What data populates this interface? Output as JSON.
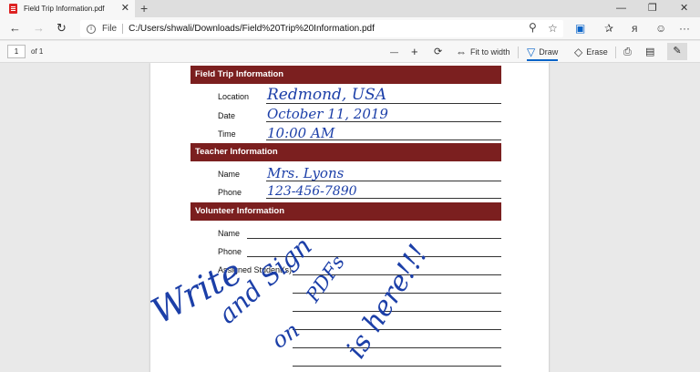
{
  "browser": {
    "tab_title": "Field Trip Information.pdf",
    "tab_close": "✕",
    "new_tab": "+",
    "window_controls": [
      "—",
      "❐",
      "✕"
    ],
    "url_scheme": "File",
    "url": "C:/Users/shwali/Downloads/Field%20Trip%20Information.pdf",
    "more": "···"
  },
  "pdf_toolbar": {
    "page_number": "1",
    "page_count": "of 1",
    "zoom_out": "—",
    "zoom_in": "+",
    "fit_label": "Fit to width",
    "draw_label": "Draw",
    "erase_label": "Erase"
  },
  "form": {
    "sections": [
      {
        "title": "Field Trip Information"
      },
      {
        "title": "Teacher Information"
      },
      {
        "title": "Volunteer Information"
      }
    ],
    "trip_fields": [
      {
        "label": "Location",
        "value": "Redmond, USA"
      },
      {
        "label": "Date",
        "value": "October 11, 2019"
      },
      {
        "label": "Time",
        "value": "10:00 AM"
      }
    ],
    "teacher_fields": [
      {
        "label": "Name",
        "value": "Mrs. Lyons"
      },
      {
        "label": "Phone",
        "value": "123-456-7890"
      }
    ],
    "volunteer_fields": [
      {
        "label": "Name"
      },
      {
        "label": "Phone"
      },
      {
        "label": "Assigned Student(s)"
      }
    ]
  },
  "ink_annotation": {
    "words": [
      "Write",
      "and Sign",
      "on",
      "PDFs",
      "is here!!!"
    ],
    "color": "#1c3fa8"
  },
  "colors": {
    "section_header": "#7b1f1f",
    "ink": "#1c3fa8",
    "accent": "#0a64c8"
  }
}
